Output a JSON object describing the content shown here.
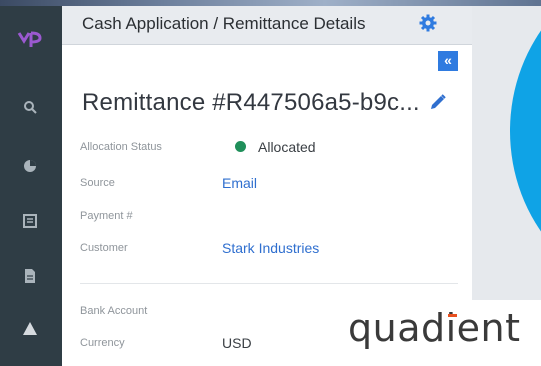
{
  "header": {
    "title": "Cash Application / Remittance Details"
  },
  "remittance": {
    "title": "Remittance #R447506a5-b9c..."
  },
  "details": {
    "allocation_status_label": "Allocation Status",
    "allocation_status_value": "Allocated",
    "source_label": "Source",
    "source_value": "Email",
    "payment_label": "Payment #",
    "customer_label": "Customer",
    "customer_value": "Stark Industries",
    "bank_account_label": "Bank Account",
    "currency_label": "Currency",
    "currency_value": "USD"
  },
  "watermark": {
    "brand": "quadient"
  },
  "colors": {
    "sidebar": "#2f3d45",
    "accent_blue": "#2f7be0",
    "link": "#2f6fcf",
    "status_green": "#1f8f5a",
    "brand_orange": "#e8501f"
  },
  "icons": {
    "sidebar": [
      "logo",
      "search-icon",
      "pie-chart-icon",
      "list-icon",
      "document-icon",
      "warning-icon"
    ],
    "header": "gear-icon",
    "panel": [
      "collapse-icon",
      "pencil-icon"
    ]
  }
}
